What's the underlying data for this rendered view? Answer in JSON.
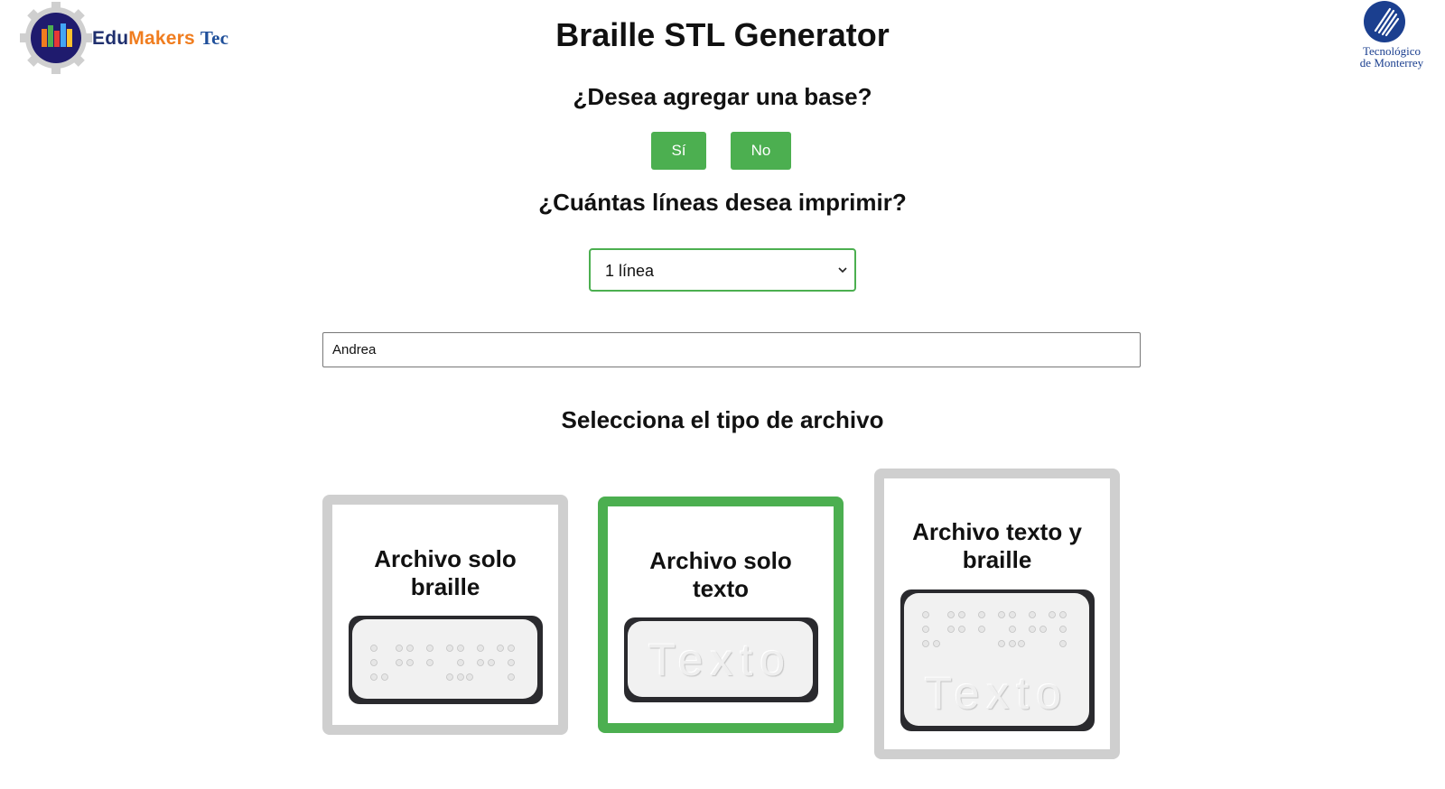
{
  "header": {
    "title": "Braille STL Generator",
    "logo_left": {
      "part1": "Edu",
      "part2": "Makers",
      "part3": "Tec"
    },
    "logo_right": {
      "line1": "Tecnológico",
      "line2": "de Monterrey"
    }
  },
  "base_question": {
    "text": "¿Desea agregar una base?",
    "yes_label": "Sí",
    "no_label": "No"
  },
  "lines_question": {
    "text": "¿Cuántas líneas desea imprimir?",
    "selected": "1 línea"
  },
  "text_input": {
    "value": "Andrea"
  },
  "file_type": {
    "heading": "Selecciona el tipo de archivo",
    "options": [
      {
        "line1": "Archivo solo",
        "line2": "braille",
        "selected": false
      },
      {
        "line1": "Archivo solo",
        "line2": "texto",
        "preview_text": "Texto",
        "selected": true
      },
      {
        "line1": "Archivo texto y",
        "line2": "braille",
        "preview_text": "Texto",
        "selected": false
      }
    ]
  },
  "colors": {
    "accent": "#4caf50",
    "card_border": "#cfcfcf",
    "plate_frame": "#2a2a2e"
  }
}
